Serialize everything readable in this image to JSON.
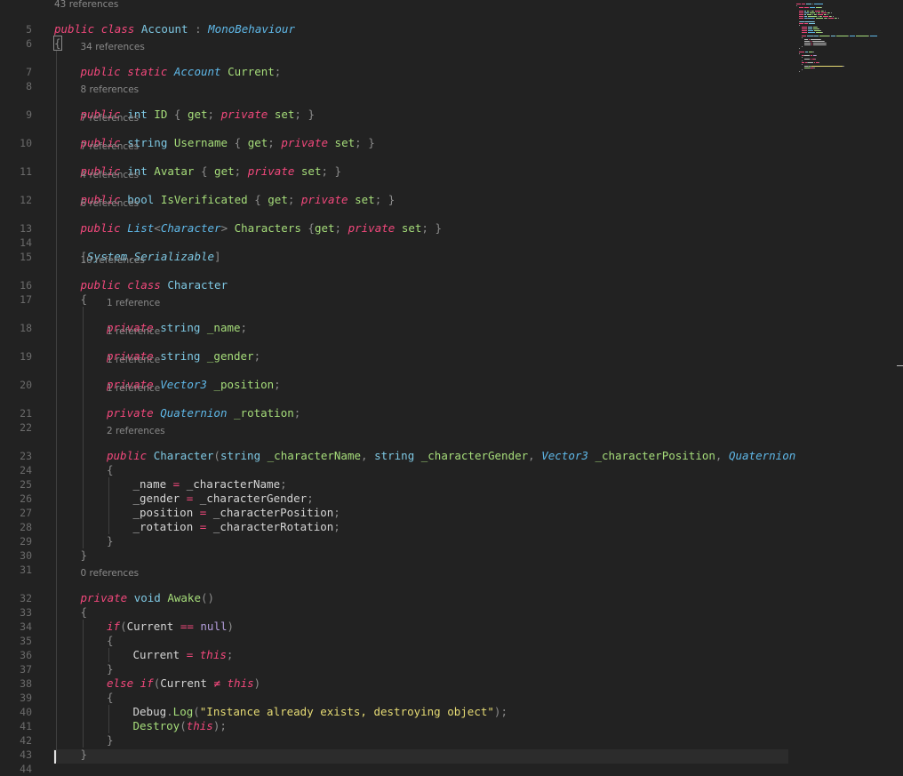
{
  "editor": {
    "lines": [
      {
        "n": "5",
        "lens": "43 references",
        "depth": 0,
        "tokens": [
          [
            "kw",
            "public"
          ],
          [
            "pl",
            " "
          ],
          [
            "kw",
            "class"
          ],
          [
            "pl",
            " "
          ],
          [
            "ty",
            "Account"
          ],
          [
            "pl",
            " "
          ],
          [
            "pu",
            ":"
          ],
          [
            "pl",
            " "
          ],
          [
            "tyi",
            "MonoBehaviour"
          ]
        ]
      },
      {
        "n": "6",
        "depth": 0,
        "tokens": [
          [
            "pu",
            "{",
            "hl"
          ]
        ]
      },
      {
        "n": "7",
        "lens": "34 references",
        "depth": 1,
        "tokens": [
          [
            "kw",
            "public"
          ],
          [
            "pl",
            " "
          ],
          [
            "kw",
            "static"
          ],
          [
            "pl",
            " "
          ],
          [
            "tyi",
            "Account"
          ],
          [
            "pl",
            " "
          ],
          [
            "id",
            "Current"
          ],
          [
            "pu",
            ";"
          ]
        ]
      },
      {
        "n": "8",
        "depth": 1,
        "tokens": []
      },
      {
        "n": "9",
        "lens": "8 references",
        "depth": 1,
        "tokens": [
          [
            "kw",
            "public"
          ],
          [
            "pl",
            " "
          ],
          [
            "ty",
            "int"
          ],
          [
            "pl",
            " "
          ],
          [
            "id",
            "ID"
          ],
          [
            "pl",
            " "
          ],
          [
            "pu",
            "{"
          ],
          [
            "pl",
            " "
          ],
          [
            "id",
            "get"
          ],
          [
            "pu",
            ";"
          ],
          [
            "pl",
            " "
          ],
          [
            "kw",
            "private"
          ],
          [
            "pl",
            " "
          ],
          [
            "id",
            "set"
          ],
          [
            "pu",
            ";"
          ],
          [
            "pl",
            " "
          ],
          [
            "pu",
            "}"
          ]
        ]
      },
      {
        "n": "10",
        "lens": "7 references",
        "depth": 1,
        "tokens": [
          [
            "kw",
            "public"
          ],
          [
            "pl",
            " "
          ],
          [
            "ty",
            "string"
          ],
          [
            "pl",
            " "
          ],
          [
            "id",
            "Username"
          ],
          [
            "pl",
            " "
          ],
          [
            "pu",
            "{"
          ],
          [
            "pl",
            " "
          ],
          [
            "id",
            "get"
          ],
          [
            "pu",
            ";"
          ],
          [
            "pl",
            " "
          ],
          [
            "kw",
            "private"
          ],
          [
            "pl",
            " "
          ],
          [
            "id",
            "set"
          ],
          [
            "pu",
            ";"
          ],
          [
            "pl",
            " "
          ],
          [
            "pu",
            "}"
          ]
        ]
      },
      {
        "n": "11",
        "lens": "7 references",
        "depth": 1,
        "tokens": [
          [
            "kw",
            "public"
          ],
          [
            "pl",
            " "
          ],
          [
            "ty",
            "int"
          ],
          [
            "pl",
            " "
          ],
          [
            "id",
            "Avatar"
          ],
          [
            "pl",
            " "
          ],
          [
            "pu",
            "{"
          ],
          [
            "pl",
            " "
          ],
          [
            "id",
            "get"
          ],
          [
            "pu",
            ";"
          ],
          [
            "pl",
            " "
          ],
          [
            "kw",
            "private"
          ],
          [
            "pl",
            " "
          ],
          [
            "id",
            "set"
          ],
          [
            "pu",
            ";"
          ],
          [
            "pl",
            " "
          ],
          [
            "pu",
            "}"
          ]
        ]
      },
      {
        "n": "12",
        "lens": "4 references",
        "depth": 1,
        "tokens": [
          [
            "kw",
            "public"
          ],
          [
            "pl",
            " "
          ],
          [
            "ty",
            "bool"
          ],
          [
            "pl",
            " "
          ],
          [
            "id",
            "IsVerificated"
          ],
          [
            "pl",
            " "
          ],
          [
            "pu",
            "{"
          ],
          [
            "pl",
            " "
          ],
          [
            "id",
            "get"
          ],
          [
            "pu",
            ";"
          ],
          [
            "pl",
            " "
          ],
          [
            "kw",
            "private"
          ],
          [
            "pl",
            " "
          ],
          [
            "id",
            "set"
          ],
          [
            "pu",
            ";"
          ],
          [
            "pl",
            " "
          ],
          [
            "pu",
            "}"
          ]
        ]
      },
      {
        "n": "13",
        "lens": "6 references",
        "depth": 1,
        "tokens": [
          [
            "kw",
            "public"
          ],
          [
            "pl",
            " "
          ],
          [
            "tyi",
            "List"
          ],
          [
            "pu",
            "<"
          ],
          [
            "tyi",
            "Character"
          ],
          [
            "pu",
            ">"
          ],
          [
            "pl",
            " "
          ],
          [
            "id",
            "Characters"
          ],
          [
            "pl",
            " "
          ],
          [
            "pu",
            "{"
          ],
          [
            "id",
            "get"
          ],
          [
            "pu",
            ";"
          ],
          [
            "pl",
            " "
          ],
          [
            "kw",
            "private"
          ],
          [
            "pl",
            " "
          ],
          [
            "id",
            "set"
          ],
          [
            "pu",
            ";"
          ],
          [
            "pl",
            " "
          ],
          [
            "pu",
            "}"
          ]
        ]
      },
      {
        "n": "14",
        "depth": 1,
        "tokens": []
      },
      {
        "n": "15",
        "depth": 1,
        "tokens": [
          [
            "pu",
            "["
          ],
          [
            "at",
            "System"
          ],
          [
            "pu",
            "."
          ],
          [
            "at",
            "Serializable"
          ],
          [
            "pu",
            "]"
          ]
        ]
      },
      {
        "n": "16",
        "lens": "10 references",
        "depth": 1,
        "tokens": [
          [
            "kw",
            "public"
          ],
          [
            "pl",
            " "
          ],
          [
            "kw",
            "class"
          ],
          [
            "pl",
            " "
          ],
          [
            "ty",
            "Character"
          ]
        ]
      },
      {
        "n": "17",
        "depth": 1,
        "tokens": [
          [
            "pu",
            "{"
          ]
        ]
      },
      {
        "n": "18",
        "lens": "1 reference",
        "depth": 2,
        "tokens": [
          [
            "kw",
            "private"
          ],
          [
            "pl",
            " "
          ],
          [
            "ty",
            "string"
          ],
          [
            "pl",
            " "
          ],
          [
            "id",
            "_name"
          ],
          [
            "pu",
            ";"
          ]
        ]
      },
      {
        "n": "19",
        "lens": "1 reference",
        "depth": 2,
        "tokens": [
          [
            "kw",
            "private"
          ],
          [
            "pl",
            " "
          ],
          [
            "ty",
            "string"
          ],
          [
            "pl",
            " "
          ],
          [
            "id",
            "_gender"
          ],
          [
            "pu",
            ";"
          ]
        ]
      },
      {
        "n": "20",
        "lens": "1 reference",
        "depth": 2,
        "tokens": [
          [
            "kw",
            "private"
          ],
          [
            "pl",
            " "
          ],
          [
            "tyi",
            "Vector3"
          ],
          [
            "pl",
            " "
          ],
          [
            "id",
            "_position"
          ],
          [
            "pu",
            ";"
          ]
        ]
      },
      {
        "n": "21",
        "lens": "1 reference",
        "depth": 2,
        "tokens": [
          [
            "kw",
            "private"
          ],
          [
            "pl",
            " "
          ],
          [
            "tyi",
            "Quaternion"
          ],
          [
            "pl",
            " "
          ],
          [
            "id",
            "_rotation"
          ],
          [
            "pu",
            ";"
          ]
        ]
      },
      {
        "n": "22",
        "depth": 2,
        "tokens": []
      },
      {
        "n": "23",
        "lens": "2 references",
        "depth": 2,
        "tokens": [
          [
            "kw",
            "public"
          ],
          [
            "pl",
            " "
          ],
          [
            "ty",
            "Character"
          ],
          [
            "pu",
            "("
          ],
          [
            "ty",
            "string"
          ],
          [
            "pl",
            " "
          ],
          [
            "id",
            "_characterName"
          ],
          [
            "pu",
            ","
          ],
          [
            "pl",
            " "
          ],
          [
            "ty",
            "string"
          ],
          [
            "pl",
            " "
          ],
          [
            "id",
            "_characterGender"
          ],
          [
            "pu",
            ","
          ],
          [
            "pl",
            " "
          ],
          [
            "tyi",
            "Vector3"
          ],
          [
            "pl",
            " "
          ],
          [
            "id",
            "_characterPosition"
          ],
          [
            "pu",
            ","
          ],
          [
            "pl",
            " "
          ],
          [
            "tyi",
            "Quaternion"
          ]
        ]
      },
      {
        "n": "24",
        "depth": 2,
        "tokens": [
          [
            "pu",
            "{"
          ]
        ]
      },
      {
        "n": "25",
        "depth": 3,
        "tokens": [
          [
            "pl",
            "_name"
          ],
          [
            "pl",
            " "
          ],
          [
            "op",
            "="
          ],
          [
            "pl",
            " "
          ],
          [
            "pl",
            "_characterName"
          ],
          [
            "pu",
            ";"
          ]
        ]
      },
      {
        "n": "26",
        "depth": 3,
        "tokens": [
          [
            "pl",
            "_gender"
          ],
          [
            "pl",
            " "
          ],
          [
            "op",
            "="
          ],
          [
            "pl",
            " "
          ],
          [
            "pl",
            "_characterGender"
          ],
          [
            "pu",
            ";"
          ]
        ]
      },
      {
        "n": "27",
        "depth": 3,
        "tokens": [
          [
            "pl",
            "_position"
          ],
          [
            "pl",
            " "
          ],
          [
            "op",
            "="
          ],
          [
            "pl",
            " "
          ],
          [
            "pl",
            "_characterPosition"
          ],
          [
            "pu",
            ";"
          ]
        ]
      },
      {
        "n": "28",
        "depth": 3,
        "tokens": [
          [
            "pl",
            "_rotation"
          ],
          [
            "pl",
            " "
          ],
          [
            "op",
            "="
          ],
          [
            "pl",
            " "
          ],
          [
            "pl",
            "_characterRotation"
          ],
          [
            "pu",
            ";"
          ]
        ]
      },
      {
        "n": "29",
        "depth": 2,
        "tokens": [
          [
            "pu",
            "}"
          ]
        ]
      },
      {
        "n": "30",
        "depth": 1,
        "tokens": [
          [
            "pu",
            "}"
          ]
        ]
      },
      {
        "n": "31",
        "depth": 1,
        "tokens": []
      },
      {
        "n": "32",
        "lens": "0 references",
        "depth": 1,
        "tokens": [
          [
            "kw",
            "private"
          ],
          [
            "pl",
            " "
          ],
          [
            "ty",
            "void"
          ],
          [
            "pl",
            " "
          ],
          [
            "id",
            "Awake"
          ],
          [
            "pu",
            "()"
          ]
        ]
      },
      {
        "n": "33",
        "depth": 1,
        "tokens": [
          [
            "pu",
            "{"
          ]
        ]
      },
      {
        "n": "34",
        "depth": 2,
        "tokens": [
          [
            "kw",
            "if"
          ],
          [
            "pu",
            "("
          ],
          [
            "pl",
            "Current"
          ],
          [
            "pl",
            " "
          ],
          [
            "op",
            "=="
          ],
          [
            "pl",
            " "
          ],
          [
            "nu",
            "null"
          ],
          [
            "pu",
            ")"
          ]
        ]
      },
      {
        "n": "35",
        "depth": 2,
        "tokens": [
          [
            "pu",
            "{"
          ]
        ]
      },
      {
        "n": "36",
        "depth": 3,
        "tokens": [
          [
            "pl",
            "Current"
          ],
          [
            "pl",
            " "
          ],
          [
            "op",
            "="
          ],
          [
            "pl",
            " "
          ],
          [
            "kw",
            "this"
          ],
          [
            "pu",
            ";"
          ]
        ]
      },
      {
        "n": "37",
        "depth": 2,
        "tokens": [
          [
            "pu",
            "}"
          ]
        ]
      },
      {
        "n": "38",
        "depth": 2,
        "tokens": [
          [
            "kw",
            "else"
          ],
          [
            "pl",
            " "
          ],
          [
            "kw",
            "if"
          ],
          [
            "pu",
            "("
          ],
          [
            "pl",
            "Current"
          ],
          [
            "pl",
            " "
          ],
          [
            "op",
            "≠"
          ],
          [
            "pl",
            " "
          ],
          [
            "kw",
            "this"
          ],
          [
            "pu",
            ")"
          ]
        ]
      },
      {
        "n": "39",
        "depth": 2,
        "tokens": [
          [
            "pu",
            "{"
          ]
        ]
      },
      {
        "n": "40",
        "depth": 3,
        "tokens": [
          [
            "pl",
            "Debug"
          ],
          [
            "pu",
            "."
          ],
          [
            "id",
            "Log"
          ],
          [
            "pu",
            "("
          ],
          [
            "st",
            "\"Instance already exists, destroying object\""
          ],
          [
            "pu",
            ");"
          ]
        ]
      },
      {
        "n": "41",
        "depth": 3,
        "tokens": [
          [
            "id",
            "Destroy"
          ],
          [
            "pu",
            "("
          ],
          [
            "kw",
            "this"
          ],
          [
            "pu",
            ");"
          ]
        ]
      },
      {
        "n": "42",
        "depth": 2,
        "tokens": [
          [
            "pu",
            "}"
          ]
        ]
      },
      {
        "n": "43",
        "depth": 1,
        "tokens": [
          [
            "pu",
            "}"
          ]
        ]
      },
      {
        "n": "44",
        "depth": 0,
        "tokens": []
      }
    ]
  }
}
